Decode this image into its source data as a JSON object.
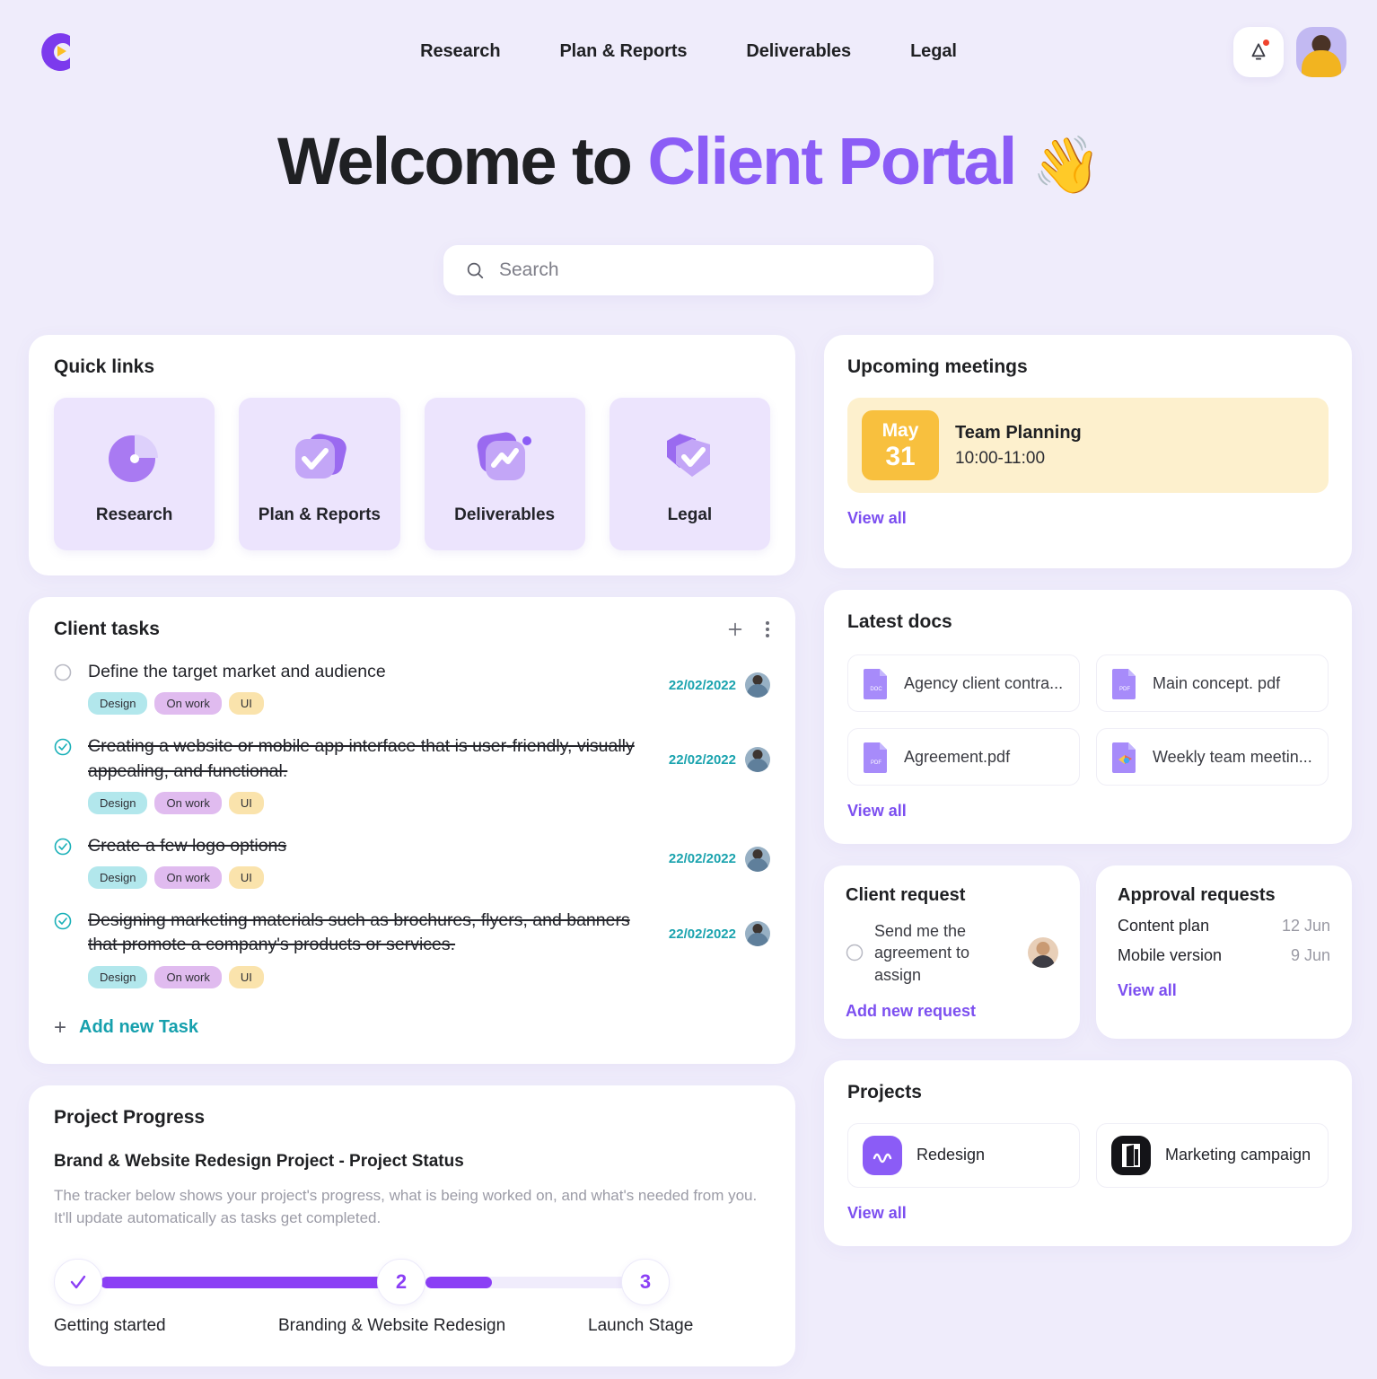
{
  "brand": {
    "logo_name": "client-portal-logo",
    "accent": "#8b5cf6",
    "teal": "#16a0ad",
    "yellow": "#f8c03e"
  },
  "nav": {
    "items": [
      {
        "label": "Research"
      },
      {
        "label": "Plan & Reports"
      },
      {
        "label": "Deliverables"
      },
      {
        "label": "Legal"
      }
    ]
  },
  "hero": {
    "prefix": "Welcome to",
    "accent": "Client Portal",
    "emoji": "👋"
  },
  "search": {
    "placeholder": "Search",
    "value": ""
  },
  "quick_links": {
    "title": "Quick links",
    "items": [
      {
        "label": "Research",
        "icon": "pie-chart-icon"
      },
      {
        "label": "Plan & Reports",
        "icon": "checked-cards-icon"
      },
      {
        "label": "Deliverables",
        "icon": "trend-chart-icon"
      },
      {
        "label": "Legal",
        "icon": "shield-check-icon"
      }
    ]
  },
  "meetings": {
    "title": "Upcoming meetings",
    "items": [
      {
        "month": "May",
        "day": "31",
        "name": "Team Planning",
        "time": "10:00-11:00"
      }
    ],
    "view_all": "View all"
  },
  "tasks": {
    "title": "Client tasks",
    "add_label": "Add new Task",
    "items": [
      {
        "text": "Define the target market and audience",
        "done": false,
        "tags": [
          "Design",
          "On work",
          "UI"
        ],
        "date": "22/02/2022"
      },
      {
        "text": "Creating a website or mobile app interface that is user-friendly, visually appealing, and functional.",
        "done": true,
        "tags": [
          "Design",
          "On work",
          "UI"
        ],
        "date": "22/02/2022"
      },
      {
        "text": "Create a few logo options",
        "done": true,
        "tags": [
          "Design",
          "On work",
          "UI"
        ],
        "date": "22/02/2022"
      },
      {
        "text": "Designing marketing materials such as brochures, flyers, and banners that promote a company's products or services.",
        "done": true,
        "tags": [
          "Design",
          "On work",
          "UI"
        ],
        "date": "22/02/2022"
      }
    ]
  },
  "docs": {
    "title": "Latest docs",
    "view_all": "View all",
    "items": [
      {
        "name": "Agency client contra...",
        "type": "DOC"
      },
      {
        "name": "Main concept. pdf",
        "type": "PDF"
      },
      {
        "name": "Agreement.pdf",
        "type": "PDF"
      },
      {
        "name": "Weekly team meetin...",
        "type": "PPT"
      }
    ]
  },
  "client_request": {
    "title": "Client request",
    "text": "Send me the agreement to assign",
    "add_label": "Add new request"
  },
  "approvals": {
    "title": "Approval requests",
    "items": [
      {
        "name": "Content plan",
        "date": "12 Jun"
      },
      {
        "name": "Mobile version",
        "date": "9 Jun"
      }
    ],
    "view_all": "View all"
  },
  "progress": {
    "title": "Project Progress",
    "subtitle": "Brand & Website Redesign Project - Project Status",
    "description": "The tracker below shows your project's progress, what is being worked on, and what's needed from you. It'll update automatically as tasks get completed.",
    "steps": [
      {
        "label": "Getting started",
        "marker": "✓",
        "state": "complete"
      },
      {
        "label": "Branding & Website Redesign",
        "marker": "2",
        "state": "active"
      },
      {
        "label": "Launch Stage",
        "marker": "3",
        "state": "pending"
      }
    ],
    "segment1_fill_pct": 100,
    "segment2_fill_pct": 30
  },
  "projects": {
    "title": "Projects",
    "view_all": "View all",
    "items": [
      {
        "name": "Redesign",
        "icon": "wave-icon",
        "color": "#8b5cf6"
      },
      {
        "name": "Marketing campaign",
        "icon": "building-icon",
        "color": "#141418"
      }
    ]
  }
}
